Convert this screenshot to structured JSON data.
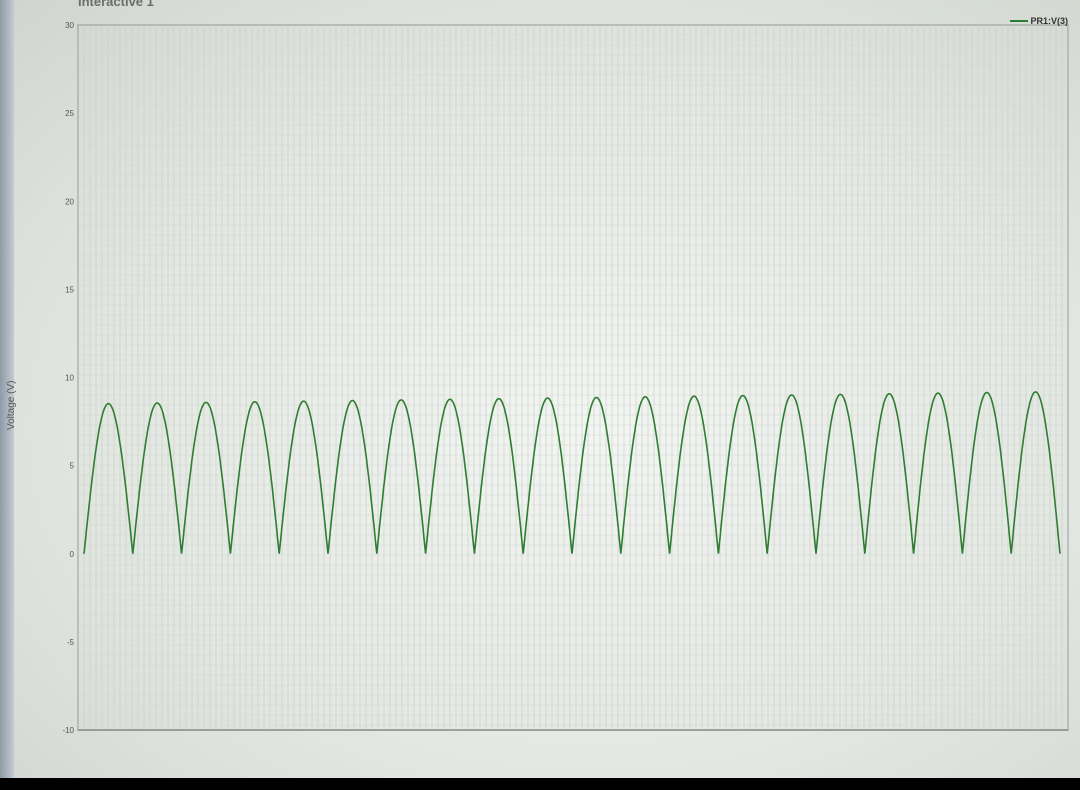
{
  "window": {
    "title": "Interactive 1"
  },
  "chart_data": {
    "type": "line",
    "title": "Interactive 1",
    "ylabel": "Voltage (V)",
    "xlabel": "",
    "ylim": [
      -10,
      30
    ],
    "yticks": [
      30,
      25,
      20,
      15,
      10,
      5,
      0,
      -5,
      -10
    ],
    "grid": true,
    "legend_position": "top-right",
    "series": [
      {
        "name": "PR1:V(3)",
        "color": "#2e7d32",
        "description_values": {
          "min": 0,
          "peak_first": 8.5,
          "peak_last": 9.2,
          "cycles": 20
        }
      }
    ]
  },
  "legend": {
    "label": "PR1:V(3)"
  }
}
